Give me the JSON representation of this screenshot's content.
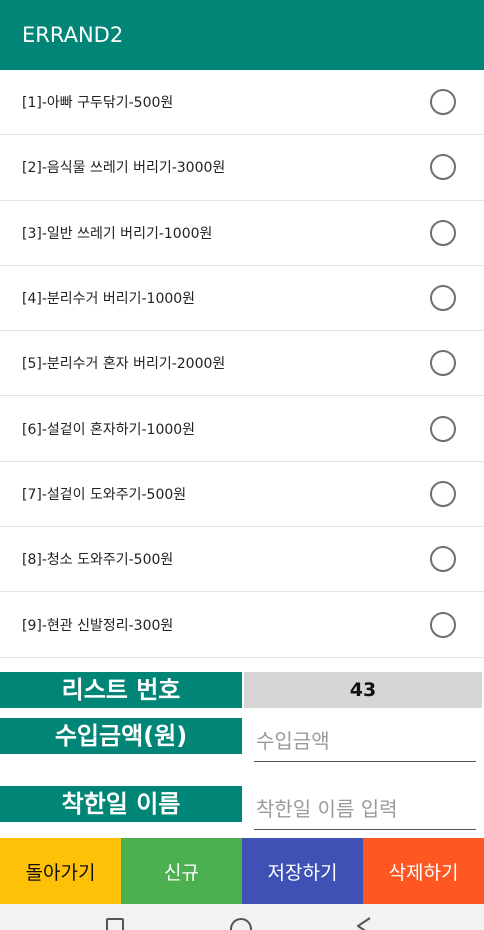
{
  "app": {
    "title": "ERRAND2"
  },
  "errands": [
    {
      "label": "[1]-아빠 구두닦기-500원"
    },
    {
      "label": "[2]-음식물 쓰레기 버리기-3000원"
    },
    {
      "label": "[3]-일반 쓰레기 버리기-1000원"
    },
    {
      "label": "[4]-분리수거 버리기-1000원"
    },
    {
      "label": "[5]-분리수거 혼자 버리기-2000원"
    },
    {
      "label": "[6]-설겉이 혼자하기-1000원"
    },
    {
      "label": "[7]-설겉이 도와주기-500원"
    },
    {
      "label": "[8]-청소 도와주기-500원"
    },
    {
      "label": "[9]-현관 신발정리-300원"
    }
  ],
  "form": {
    "list_number": {
      "label": "리스트 번호",
      "value": "43"
    },
    "income": {
      "label": "수입금액(원)",
      "placeholder": "수입금액"
    },
    "good_deed": {
      "label": "착한일 이름",
      "placeholder": "착한일 이름 입력"
    }
  },
  "buttons": {
    "back": "돌아가기",
    "new": "신규",
    "save": "저장하기",
    "delete": "삭제하기"
  },
  "colors": {
    "primary": "#008577",
    "back": "#ffc107",
    "new": "#4caf50",
    "save": "#3f51b5",
    "delete": "#ff5722"
  },
  "icons": {
    "nav_recent": "square-icon",
    "nav_home": "circle-icon",
    "nav_back": "triangle-back-icon"
  }
}
